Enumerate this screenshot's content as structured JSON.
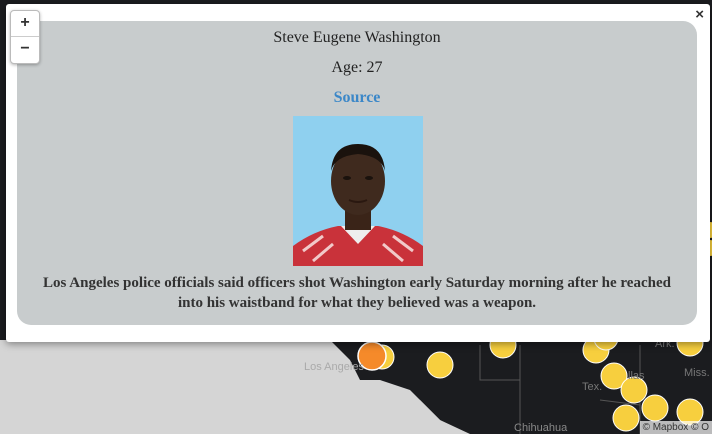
{
  "map": {
    "zoom_in": "+",
    "zoom_out": "−",
    "labels": {
      "los_angeles": "Los Angeles",
      "tex": "Tex.",
      "miss": "Miss.",
      "ark": "Ark.",
      "dallas": "llas",
      "chihuahua": "Chihuahua"
    },
    "attribution": "© Mapbox © O",
    "marker_colors": {
      "default": "#f7cf3e",
      "selected": "#f58a2a"
    }
  },
  "popup": {
    "close": "×",
    "name": "Steve Eugene Washington",
    "age": "Age: 27",
    "source": "Source",
    "description": "Los Angeles police officials said officers shot Washington early Saturday morning after he reached into his waistband for what they believed was a weapon."
  }
}
